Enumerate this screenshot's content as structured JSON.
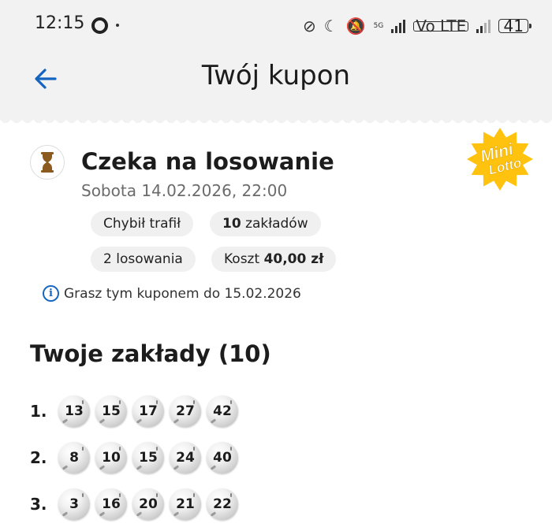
{
  "status_bar": {
    "time": "12:15",
    "network": "5G",
    "volte": "Vo LTE",
    "battery": "41"
  },
  "header": {
    "title": "Twój kupon"
  },
  "ticket": {
    "status_title": "Czeka na losowanie",
    "draw_date": "Sobota 14.02.2026, 22:00",
    "game_logo_text": [
      "Mini",
      "Lotto"
    ],
    "chips": {
      "chybil_trafil": "Chybił trafił",
      "bets_count_bold": "10",
      "bets_count_text": "zakładów",
      "draws": "2 losowania",
      "cost_label": "Koszt",
      "cost_value": "40,00 zł"
    },
    "info_text": "Grasz tym kuponem do 15.02.2026"
  },
  "bets": {
    "section_title": "Twoje zakłady (10)",
    "rows": [
      {
        "label": "1.",
        "numbers": [
          "13",
          "15",
          "17",
          "27",
          "42"
        ]
      },
      {
        "label": "2.",
        "numbers": [
          "8",
          "10",
          "15",
          "24",
          "40"
        ]
      },
      {
        "label": "3.",
        "numbers": [
          "3",
          "16",
          "20",
          "21",
          "22"
        ]
      }
    ]
  },
  "colors": {
    "accent_blue": "#1565c0",
    "logo_yellow": "#ffc20e",
    "hourglass_brown": "#8b5a1f"
  }
}
